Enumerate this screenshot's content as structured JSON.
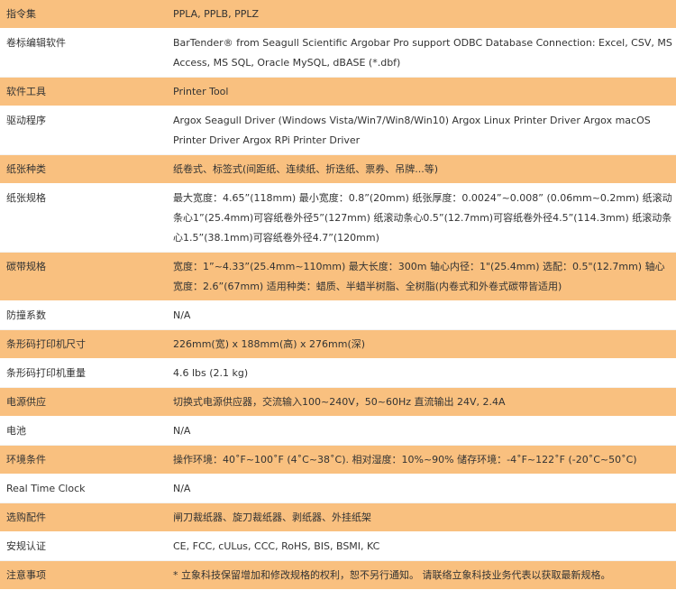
{
  "rows": [
    {
      "label": "指令集",
      "value": "PPLA, PPLB, PPLZ"
    },
    {
      "label": "卷标编辑软件",
      "value": "BarTender® from Seagull Scientific Argobar Pro support ODBC Database Connection: Excel, CSV, MS Access, MS SQL, Oracle MySQL, dBASE (*.dbf)"
    },
    {
      "label": "软件工具",
      "value": "Printer Tool"
    },
    {
      "label": "驱动程序",
      "value": "Argox Seagull Driver (Windows Vista/Win7/Win8/Win10) Argox Linux Printer Driver Argox macOS Printer Driver Argox RPi Printer Driver"
    },
    {
      "label": "纸张种类",
      "value": "纸卷式、标签式(间距纸、连续纸、折迭纸、票券、吊牌...等)"
    },
    {
      "label": "纸张规格",
      "value": "最大宽度：4.65”(118mm) 最小宽度：0.8”(20mm) 纸张厚度：0.0024”~0.008” (0.06mm~0.2mm) 纸滚动条心1”(25.4mm)可容纸卷外径5”(127mm) 纸滚动条心0.5”(12.7mm)可容纸卷外径4.5”(114.3mm) 纸滚动条心1.5”(38.1mm)可容纸卷外径4.7”(120mm)"
    },
    {
      "label": "碳带规格",
      "value": "宽度：1”~4.33”(25.4mm~110mm) 最大长度：300m 轴心内径：1\"(25.4mm) 选配：0.5\"(12.7mm) 轴心宽度：2.6”(67mm) 适用种类：蜡质、半蜡半树脂、全树脂(内卷式和外卷式碳带皆适用)"
    },
    {
      "label": "防撞系数",
      "value": "N/A"
    },
    {
      "label": "条形码打印机尺寸",
      "value": "226mm(宽) x 188mm(高) x 276mm(深)"
    },
    {
      "label": "条形码打印机重量",
      "value": "4.6 lbs (2.1 kg)"
    },
    {
      "label": "电源供应",
      "value": "切换式电源供应器，交流输入100~240V，50~60Hz 直流输出 24V, 2.4A"
    },
    {
      "label": "电池",
      "value": "N/A"
    },
    {
      "label": "环境条件",
      "value": "操作环境：40˚F~100˚F (4˚C~38˚C). 相对湿度：10%~90% 储存环境：-4˚F~122˚F (-20˚C~50˚C)"
    },
    {
      "label": "Real Time Clock",
      "value": "N/A"
    },
    {
      "label": "选购配件",
      "value": "闸刀裁纸器、旋刀裁纸器、剥纸器、外挂纸架"
    },
    {
      "label": "安规认证",
      "value": "CE, FCC, cULus, CCC, RoHS, BIS, BSMI, KC"
    },
    {
      "label": "注意事项",
      "value": "* 立象科技保留增加和修改规格的权利，恕不另行通知。 请联络立象科技业务代表以获取最新规格。"
    }
  ],
  "colors": {
    "row_accent": "#f9c07f",
    "row_plain": "#ffffff",
    "text": "#333333"
  }
}
